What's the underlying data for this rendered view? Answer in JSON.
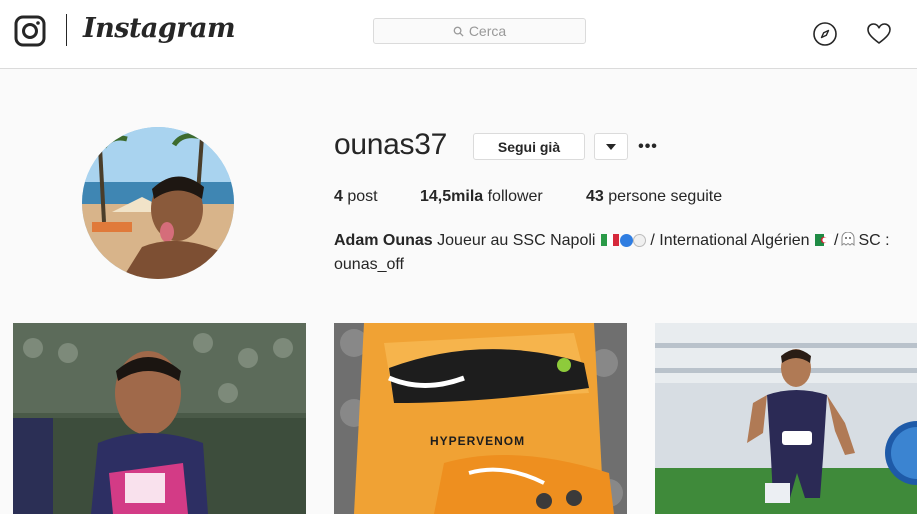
{
  "nav": {
    "wordmark": "Instagram",
    "search_placeholder": "Cerca",
    "icons": [
      "instagram-glyph-icon",
      "search-icon",
      "compass-icon",
      "heart-icon"
    ]
  },
  "profile": {
    "username": "ounas37",
    "follow_label": "Segui già",
    "more_label": "•••",
    "stats": {
      "posts_count": "4",
      "posts_label": "post",
      "followers_count": "14,5mila",
      "followers_label": "follower",
      "following_count": "43",
      "following_label": "persone seguite"
    },
    "bio": {
      "full_name": "Adam Ounas",
      "text_1": "Joueur au SSC Napoli",
      "text_2": "/ International Algérien",
      "text_3": "SC :",
      "text_4": "ounas_off"
    }
  },
  "posts": [
    {
      "alt": "football-player-photo"
    },
    {
      "alt": "orange-football-boots-photo"
    },
    {
      "alt": "football-player-running-photo"
    }
  ],
  "colors": {
    "page_bg": "#fafafa",
    "border": "#dbdbdb",
    "text": "#262626",
    "muted": "#999999"
  }
}
